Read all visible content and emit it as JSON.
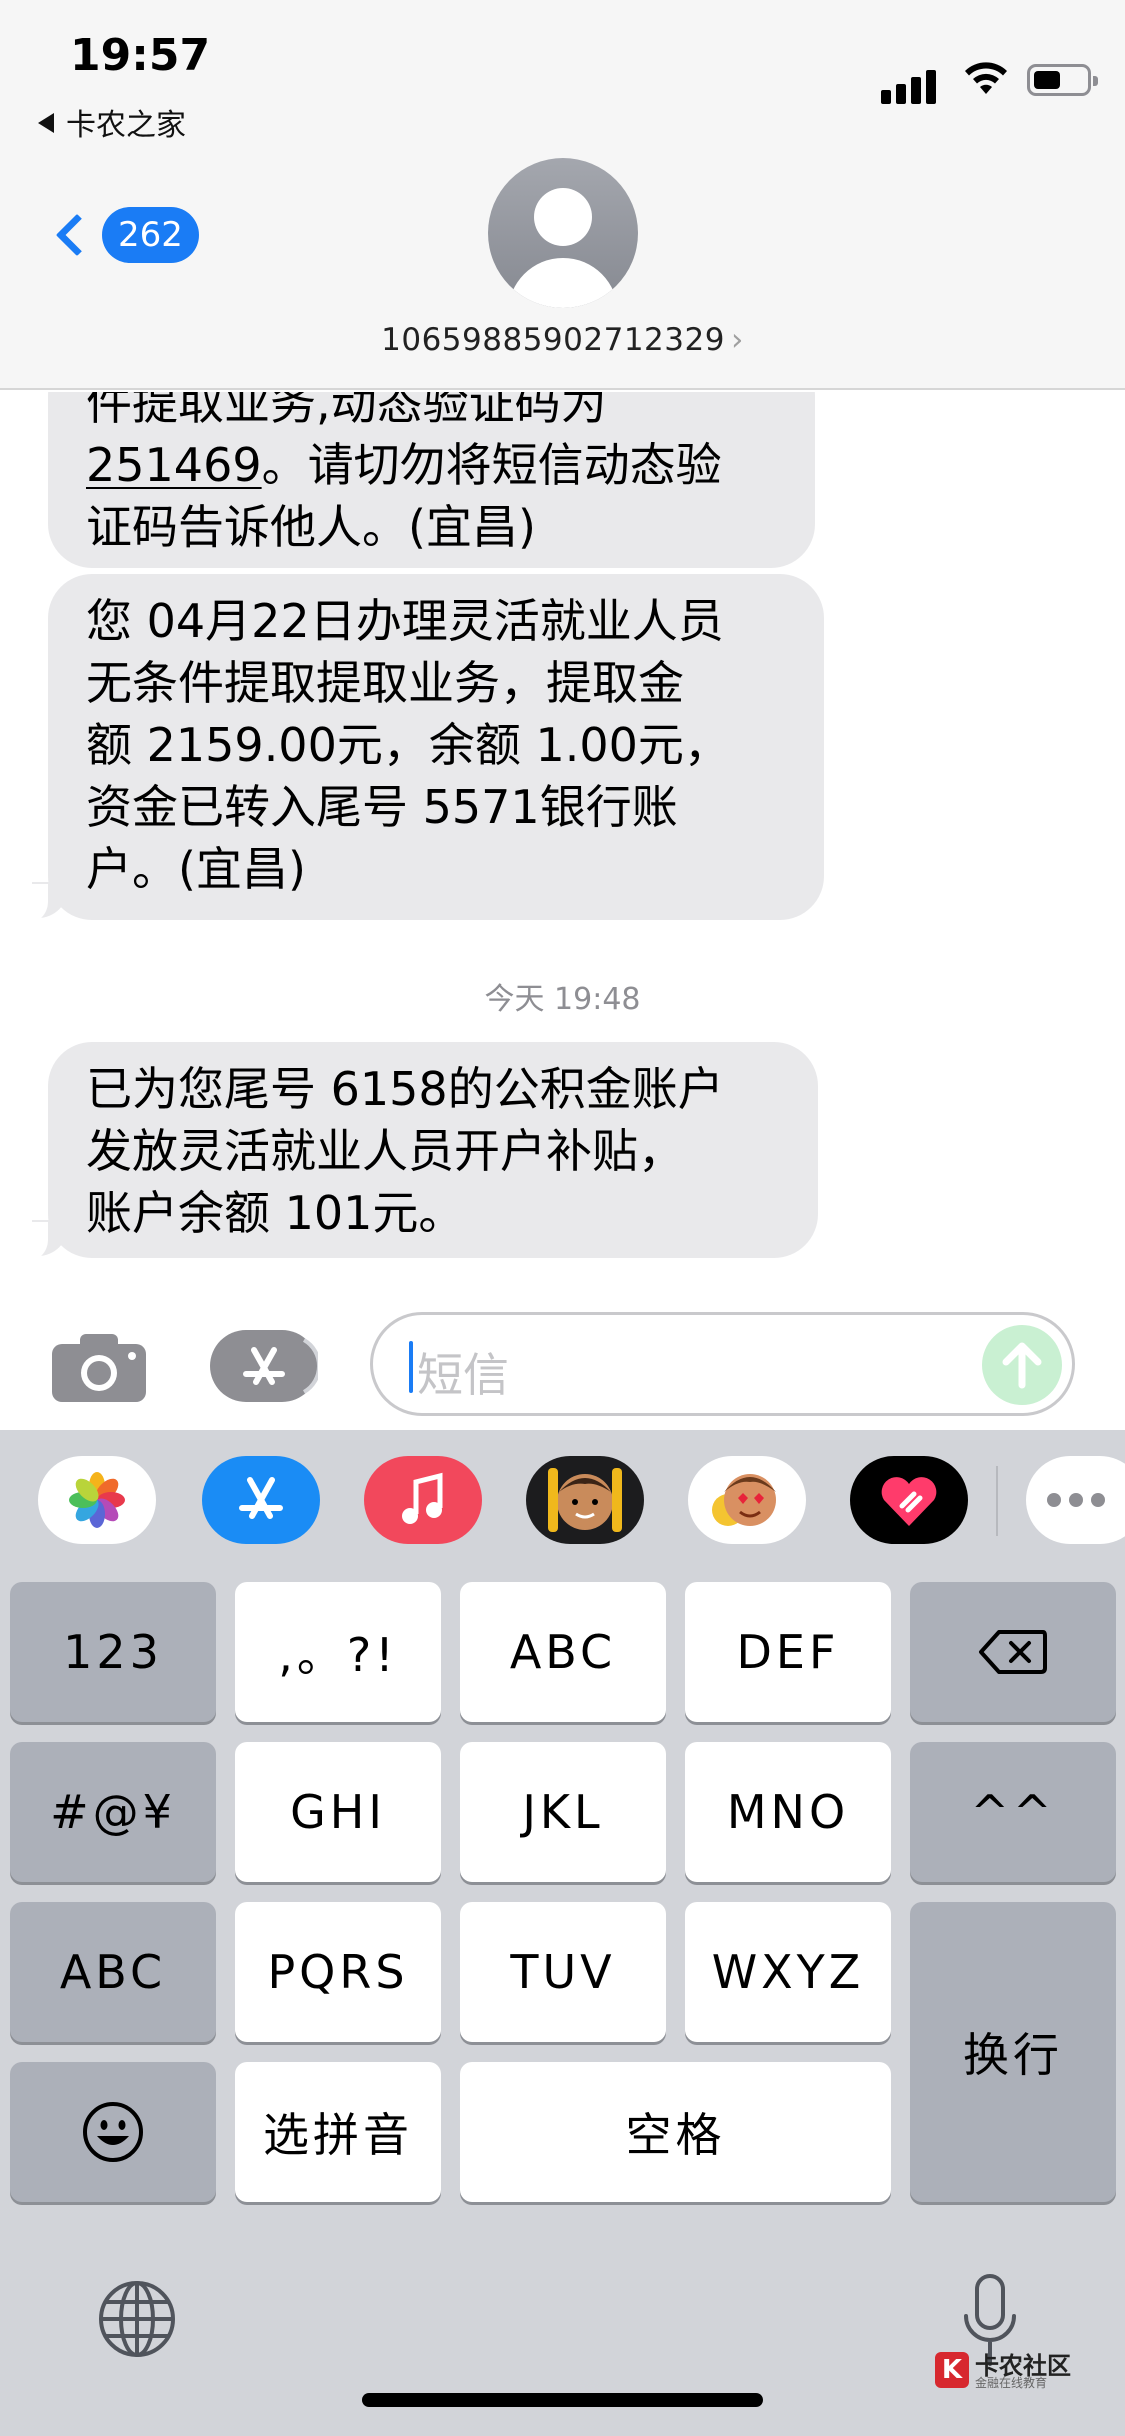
{
  "status_bar": {
    "time": "19:57",
    "back_to_app": "卡农之家",
    "icons": [
      "signal-icon",
      "wifi-icon",
      "battery-icon"
    ]
  },
  "header": {
    "back_badge": "262",
    "contact_number": "10659885902712329",
    "contact_arrow": "›"
  },
  "messages": [
    {
      "lines": [
        "件提取业务,动态验证码为",
        "251469。请切勿将短信动态验",
        "证码告诉他人。(宜昌)"
      ],
      "underlined_code": "251469"
    },
    {
      "lines": [
        "您 04月22日办理灵活就业人员",
        "无条件提取提取业务，提取金",
        "额 2159.00元，余额 1.00元，",
        "资金已转入尾号 5571银行账",
        "户。(宜昌)"
      ]
    },
    {
      "lines": [
        "已为您尾号 6158的公积金账户",
        "发放灵活就业人员开户补贴，",
        "账户余额 101元。"
      ]
    }
  ],
  "timestamp": "今天 19:48",
  "input": {
    "placeholder": "短信"
  },
  "app_drawer": [
    "photos-icon",
    "appstore-icon",
    "music-icon",
    "memoji-icon",
    "memoji-stickers-icon",
    "digital-touch-icon",
    "more-icon"
  ],
  "keyboard": {
    "row1": [
      "123",
      ",。?!",
      "ABC",
      "DEF"
    ],
    "row2": [
      "#@¥",
      "GHI",
      "JKL",
      "MNO",
      "^^"
    ],
    "row3": [
      "ABC",
      "PQRS",
      "TUV",
      "WXYZ"
    ],
    "row4": [
      "选拼音",
      "空格"
    ],
    "return_key": "换行"
  },
  "watermark": {
    "mark": "K",
    "title": "卡农社区",
    "subtitle": "金融在线教育"
  },
  "colors": {
    "ios_blue": "#1a7cf5",
    "bubble_gray": "#e9e9eb",
    "keyboard_bg": "#d2d4d9",
    "send_disabled": "#c9f0d2"
  }
}
